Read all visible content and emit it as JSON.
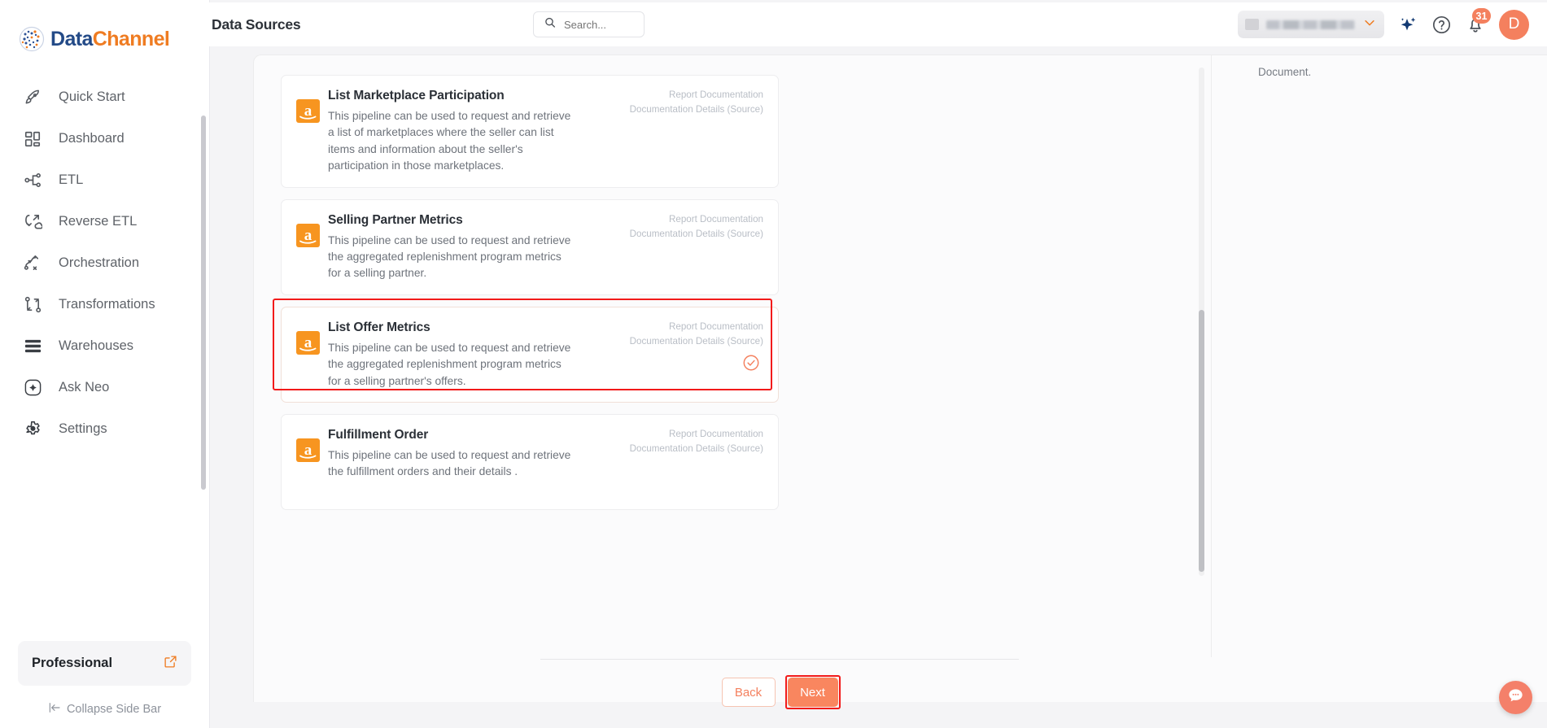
{
  "brand": {
    "logo_data": "Data",
    "logo_channel": "Channel",
    "accent_orange": "#ef7c22",
    "accent_blue": "#234a87",
    "accent_coral": "#f4805e",
    "highlight_red": "#f21a1a",
    "amazon_orange": "#f79520"
  },
  "sidebar": {
    "items": [
      {
        "label": "Quick Start",
        "icon": "rocket-icon"
      },
      {
        "label": "Dashboard",
        "icon": "grid-icon"
      },
      {
        "label": "ETL",
        "icon": "etl-icon"
      },
      {
        "label": "Reverse ETL",
        "icon": "reverse-etl-icon"
      },
      {
        "label": "Orchestration",
        "icon": "orchestration-icon"
      },
      {
        "label": "Transformations",
        "icon": "transformations-icon"
      },
      {
        "label": "Warehouses",
        "icon": "warehouse-icon"
      },
      {
        "label": "Ask Neo",
        "icon": "sparkle-circle-icon"
      },
      {
        "label": "Settings",
        "icon": "gear-icon"
      }
    ],
    "plan": {
      "name": "Professional",
      "action_icon": "external-link-icon"
    },
    "collapse": {
      "label": "Collapse Side Bar",
      "icon": "collapse-left-icon"
    }
  },
  "header": {
    "title": "Data Sources",
    "search": {
      "value": "",
      "placeholder": "Search...",
      "icon": "search-icon"
    },
    "workspace": {
      "name": "",
      "chevron": "chevron-down-icon",
      "thumb": "workspace-thumb-icon"
    },
    "sparkle_icon": "sparkle-icon",
    "help_icon": "help-circle-icon",
    "notifications": {
      "icon": "bell-icon",
      "count": "31"
    },
    "avatar": {
      "initial": "D"
    }
  },
  "main": {
    "right_fragment": "Document.",
    "cards": [
      {
        "title": "List Marketplace Participation",
        "description": "This pipeline can be used to request and retrieve a list of marketplaces where the seller can list items and information about the seller's participation in those marketplaces.",
        "link_report": "Report Documentation",
        "link_details": "Documentation Details (Source)",
        "icon": "amazon-icon",
        "selected": false
      },
      {
        "title": "Selling Partner Metrics",
        "description": "This pipeline can be used to request and retrieve the aggregated replenishment program metrics for a selling partner.",
        "link_report": "Report Documentation",
        "link_details": "Documentation Details (Source)",
        "icon": "amazon-icon",
        "selected": false
      },
      {
        "title": "List Offer Metrics",
        "description": "This pipeline can be used to request and retrieve the aggregated replenishment program metrics for a selling partner's offers.",
        "link_report": "Report Documentation",
        "link_details": "Documentation Details (Source)",
        "icon": "amazon-icon",
        "selected": true
      },
      {
        "title": "Fulfillment Order",
        "description": "This pipeline can be used to request and retrieve the fulfillment orders and their details .",
        "link_report": "Report Documentation",
        "link_details": "Documentation Details (Source)",
        "icon": "amazon-icon",
        "selected": false
      }
    ],
    "buttons": {
      "back": "Back",
      "next": "Next"
    }
  },
  "chat": {
    "icon": "chat-bubble-icon"
  }
}
